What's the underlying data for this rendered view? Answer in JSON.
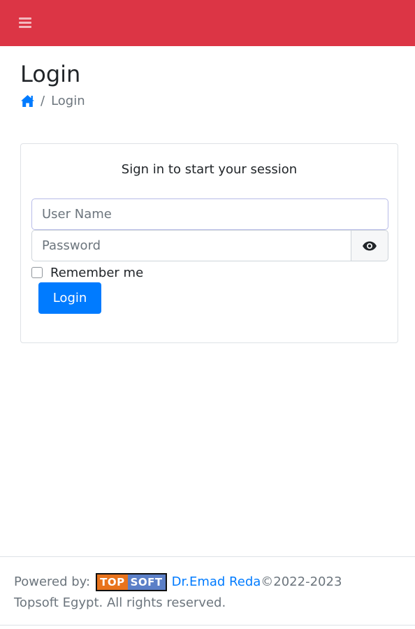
{
  "navbar": {
    "menu_icon": "hamburger-icon",
    "color": "#dc3545"
  },
  "header": {
    "title": "Login"
  },
  "breadcrumb": {
    "home_icon": "home-icon",
    "separator": "/",
    "current": "Login"
  },
  "login_card": {
    "message": "Sign in to start your session",
    "username_placeholder": "User Name",
    "password_placeholder": "Password",
    "toggle_password_icon": "eye-icon",
    "remember_label": "Remember me",
    "login_button": "Login",
    "button_color": "#007bff"
  },
  "footer": {
    "powered_by": "Powered by:",
    "logo_top": "TOP",
    "logo_soft": "SOFT",
    "author_link": "Dr.Emad Reda",
    "years": "©2022-2023",
    "rights": "Topsoft Egypt. All rights reserved."
  }
}
